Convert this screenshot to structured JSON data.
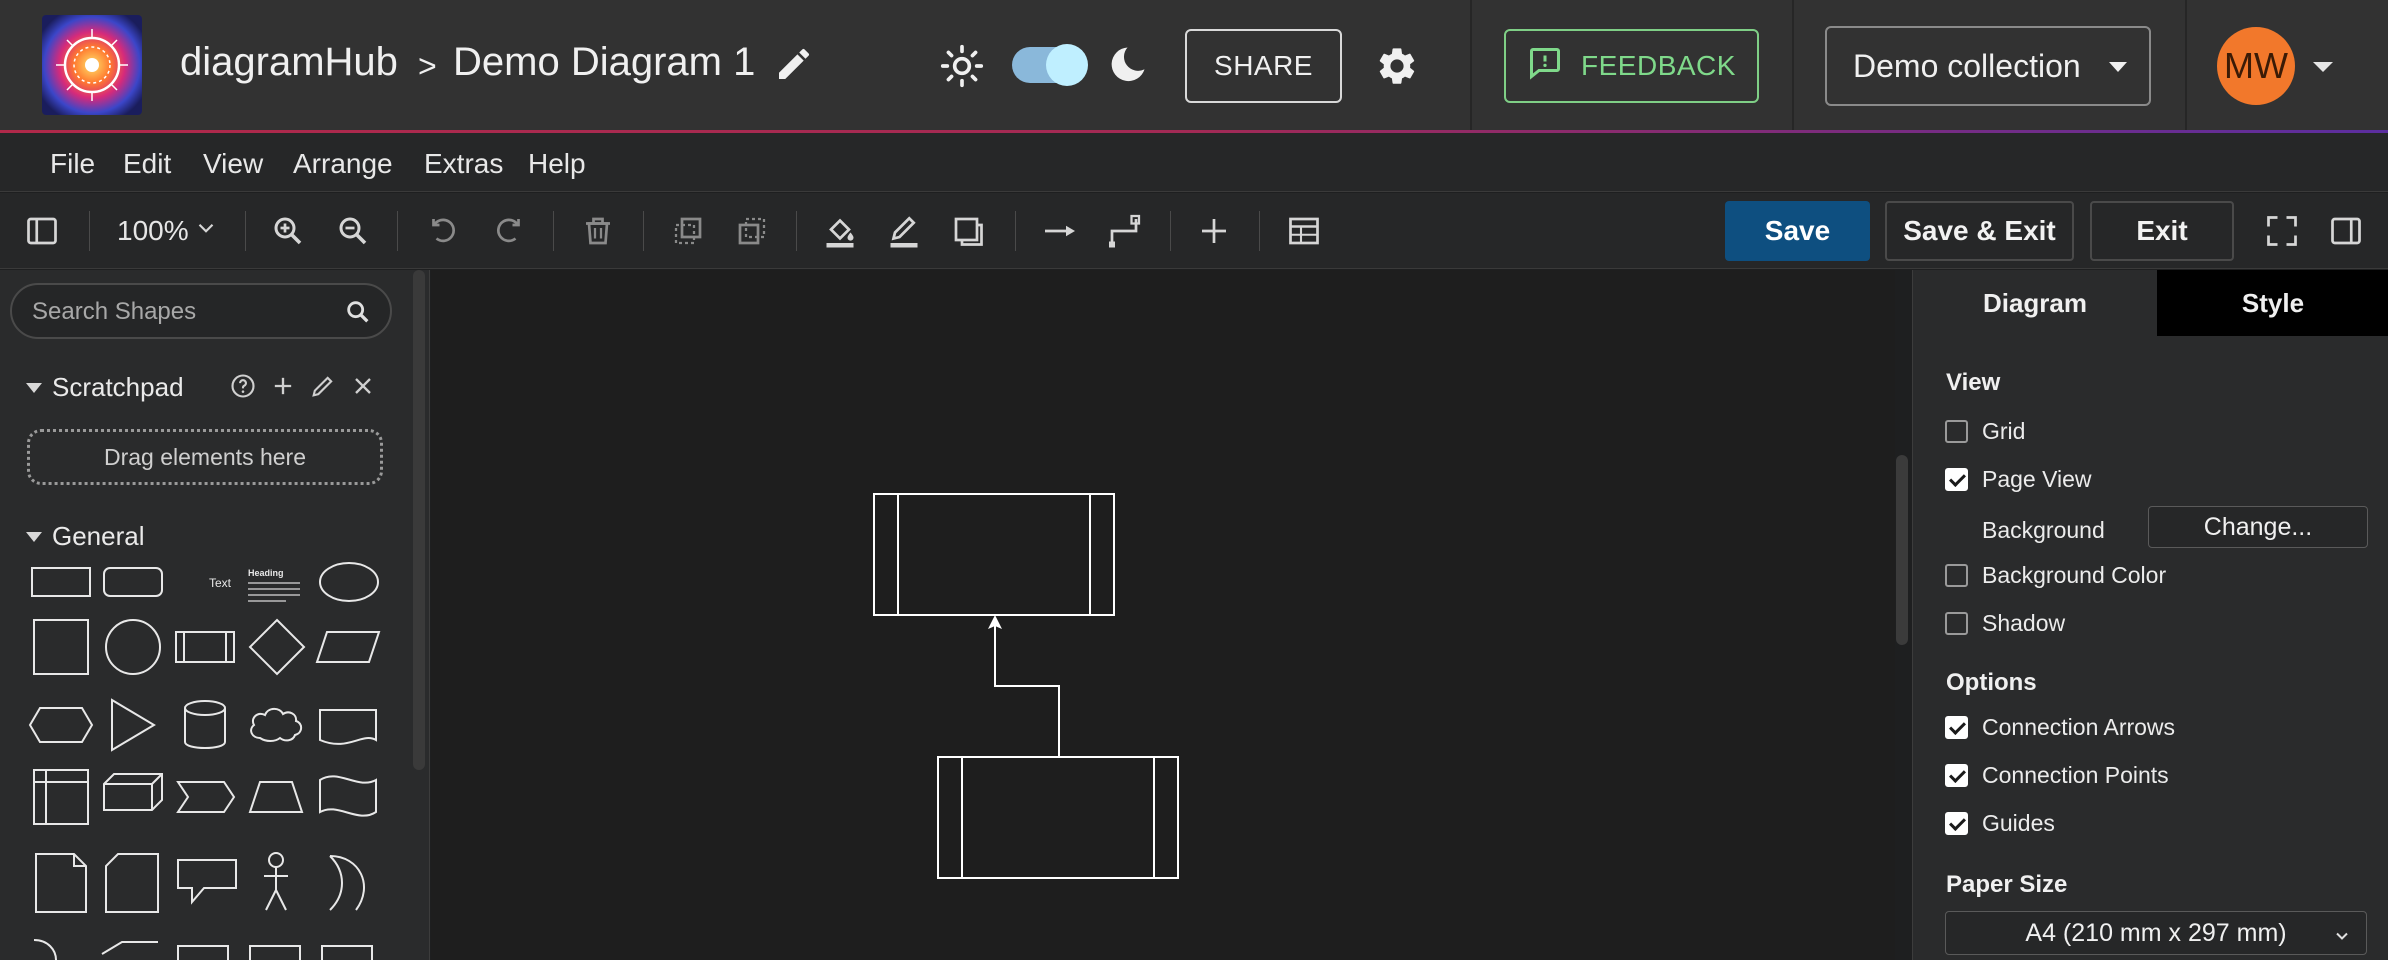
{
  "header": {
    "app_name": "diagramHub",
    "separator": ">",
    "document_title": "Demo Diagram 1",
    "share_label": "SHARE",
    "feedback_label": "FEEDBACK",
    "collection": "Demo collection",
    "avatar_initials": "MW",
    "accent_color": "#7fd98a",
    "avatar_color": "#f2782b"
  },
  "menubar": {
    "items": [
      "File",
      "Edit",
      "View",
      "Arrange",
      "Extras",
      "Help"
    ]
  },
  "toolbar": {
    "zoom": "100%",
    "save_label": "Save",
    "save_exit_label": "Save & Exit",
    "exit_label": "Exit",
    "save_color": "#0e4f80",
    "icons": [
      "sidebar-toggle-icon",
      "zoom-in-icon",
      "zoom-out-icon",
      "undo-icon",
      "redo-icon",
      "delete-icon",
      "to-front-icon",
      "to-back-icon",
      "fill-color-icon",
      "line-color-icon",
      "shadow-icon",
      "connection-arrow-icon",
      "waypoint-icon",
      "insert-plus-icon",
      "table-icon",
      "fullscreen-icon",
      "format-panel-icon"
    ]
  },
  "shapes_panel": {
    "search_placeholder": "Search Shapes",
    "scratchpad_title": "Scratchpad",
    "scratchpad_drop_text": "Drag elements here",
    "general_title": "General",
    "text_shape_label": "Text",
    "heading_shape_label": "Heading"
  },
  "format_panel": {
    "tabs": [
      "Diagram",
      "Style"
    ],
    "view_heading": "View",
    "grid": {
      "label": "Grid",
      "checked": false
    },
    "page_view": {
      "label": "Page View",
      "checked": true
    },
    "background_label": "Background",
    "change_label": "Change...",
    "background_color": {
      "label": "Background Color",
      "checked": false
    },
    "shadow": {
      "label": "Shadow",
      "checked": false
    },
    "options_heading": "Options",
    "connection_arrows": {
      "label": "Connection Arrows",
      "checked": true
    },
    "connection_points": {
      "label": "Connection Points",
      "checked": true
    },
    "guides": {
      "label": "Guides",
      "checked": true
    },
    "paper_size_heading": "Paper Size",
    "paper_size": "A4 (210 mm x 297 mm)"
  }
}
